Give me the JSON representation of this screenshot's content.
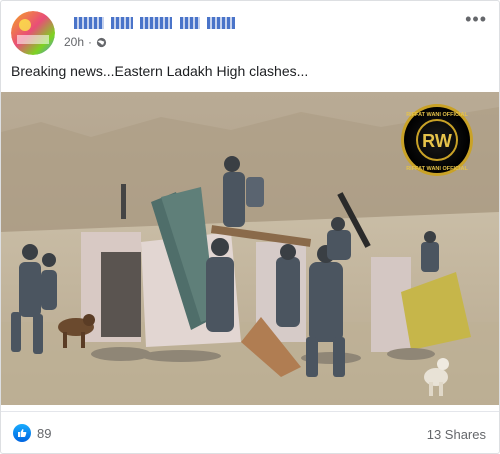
{
  "post": {
    "author_name": "",
    "timestamp": "20h",
    "privacy_icon": "globe-icon",
    "separator": "·",
    "text": "Breaking news...Eastern Ladakh High clashes..."
  },
  "photo": {
    "watermark_top": "RIFFAT WANI OFFICIAL",
    "watermark_logo": "RW",
    "watermark_bottom": "RIFFAT WANI OFFICIAL"
  },
  "footer": {
    "like_count": "89",
    "shares": "13 Shares"
  },
  "colors": {
    "accent": "#1877f2",
    "muted": "#65676b"
  }
}
